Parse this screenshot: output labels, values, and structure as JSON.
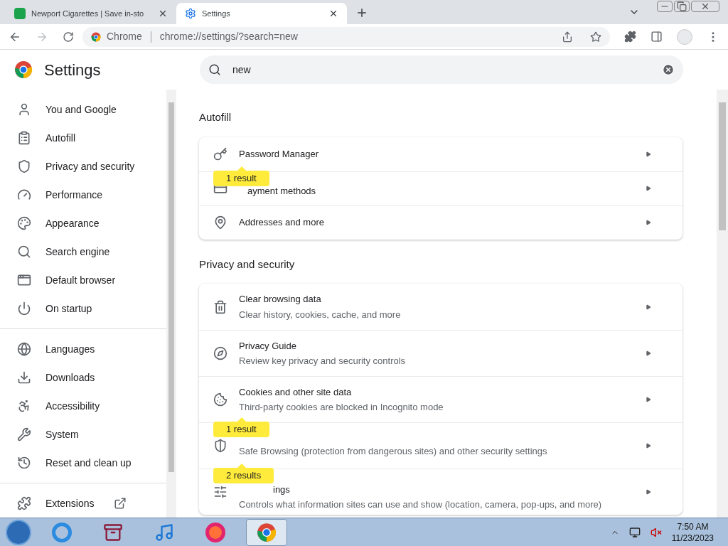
{
  "tabs": [
    {
      "title": "Newport Cigarettes | Save in-sto",
      "selected": false
    },
    {
      "title": "Settings",
      "selected": true
    }
  ],
  "toolbar": {
    "site_label": "Chrome",
    "url": "chrome://settings/?search=new"
  },
  "header": {
    "title": "Settings",
    "search": {
      "value": "new"
    }
  },
  "sidebar": {
    "groups": [
      [
        {
          "label": "You and Google"
        },
        {
          "label": "Autofill"
        },
        {
          "label": "Privacy and security"
        },
        {
          "label": "Performance"
        },
        {
          "label": "Appearance"
        },
        {
          "label": "Search engine"
        },
        {
          "label": "Default browser"
        },
        {
          "label": "On startup"
        }
      ],
      [
        {
          "label": "Languages"
        },
        {
          "label": "Downloads"
        },
        {
          "label": "Accessibility"
        },
        {
          "label": "System"
        },
        {
          "label": "Reset and clean up"
        }
      ],
      [
        {
          "label": "Extensions"
        }
      ]
    ]
  },
  "sections": [
    {
      "title": "Autofill",
      "rows": [
        {
          "title": "Password Manager"
        },
        {
          "title": "ayment methods",
          "bubble": "1 result"
        },
        {
          "title": "Addresses and more"
        }
      ]
    },
    {
      "title": "Privacy and security",
      "rows": [
        {
          "title": "Clear browsing data",
          "subtitle": "Clear history, cookies, cache, and more"
        },
        {
          "title": "Privacy Guide",
          "subtitle": "Review key privacy and security controls"
        },
        {
          "title": "Cookies and other site data",
          "subtitle": "Third-party cookies are blocked in Incognito mode"
        },
        {
          "subtitle": "Safe Browsing (protection from dangerous sites) and other security settings",
          "bubble": "1 result"
        },
        {
          "title": "ings",
          "subtitle": "Controls what information sites can use and show (location, camera, pop-ups, and more)",
          "bubble": "2 results"
        }
      ]
    }
  ],
  "taskbar": {
    "apps": [
      {
        "selected": false
      },
      {
        "selected": false
      },
      {
        "selected": false
      },
      {
        "selected": false
      },
      {
        "selected": true
      }
    ],
    "time": "7:50 AM",
    "date": "11/23/2023"
  }
}
